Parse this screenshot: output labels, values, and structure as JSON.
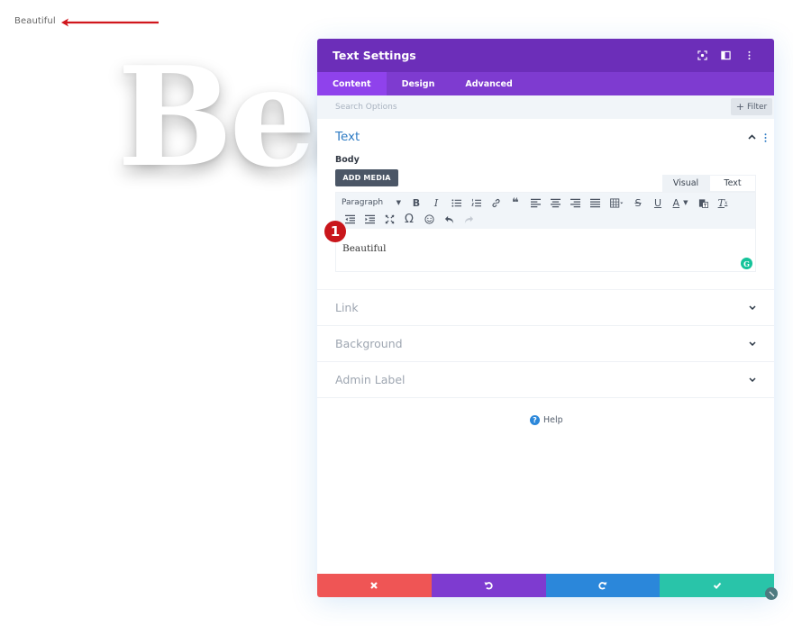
{
  "page": {
    "small_text": "Beautiful",
    "big_text": "Bea",
    "arrow_color": "#d0161c"
  },
  "panel": {
    "title": "Text Settings",
    "header_icons": [
      "focus-icon",
      "split-view-icon",
      "more-vertical-icon"
    ],
    "tabs": [
      {
        "label": "Content",
        "active": true
      },
      {
        "label": "Design",
        "active": false
      },
      {
        "label": "Advanced",
        "active": false
      }
    ],
    "search": {
      "placeholder": "Search Options",
      "value": ""
    },
    "filter_label": "Filter",
    "sections": {
      "text": {
        "title": "Text",
        "body_label": "Body",
        "add_media_label": "ADD MEDIA",
        "mode_tabs": {
          "visual": "Visual",
          "text": "Text"
        },
        "toolbar": {
          "format_select": "Paragraph",
          "row1": [
            "bold",
            "italic",
            "bulleted-list",
            "numbered-list",
            "link",
            "blockquote",
            "align-left",
            "align-center",
            "align-right",
            "justify",
            "table",
            "strikethrough",
            "underline",
            "text-color",
            "paste-as-text",
            "clear-formatting"
          ],
          "row2": [
            "outdent",
            "indent",
            "fullscreen",
            "special-character",
            "emoji",
            "undo",
            "redo"
          ]
        },
        "content": "Beautiful",
        "grammarly_label": "G",
        "step_badge": "1"
      },
      "link": {
        "title": "Link"
      },
      "background": {
        "title": "Background"
      },
      "admin_label": {
        "title": "Admin Label"
      }
    },
    "help_label": "Help",
    "footer": {
      "cancel_color": "#ef5555",
      "undo_color": "#7e3bd0",
      "redo_color": "#2b87da",
      "save_color": "#29c4a9"
    },
    "colors": {
      "header": "#6c2eb9",
      "tabs": "#7e3bd0",
      "active_tab": "#8f42ec",
      "section_title_active": "#2e7bc4"
    }
  }
}
